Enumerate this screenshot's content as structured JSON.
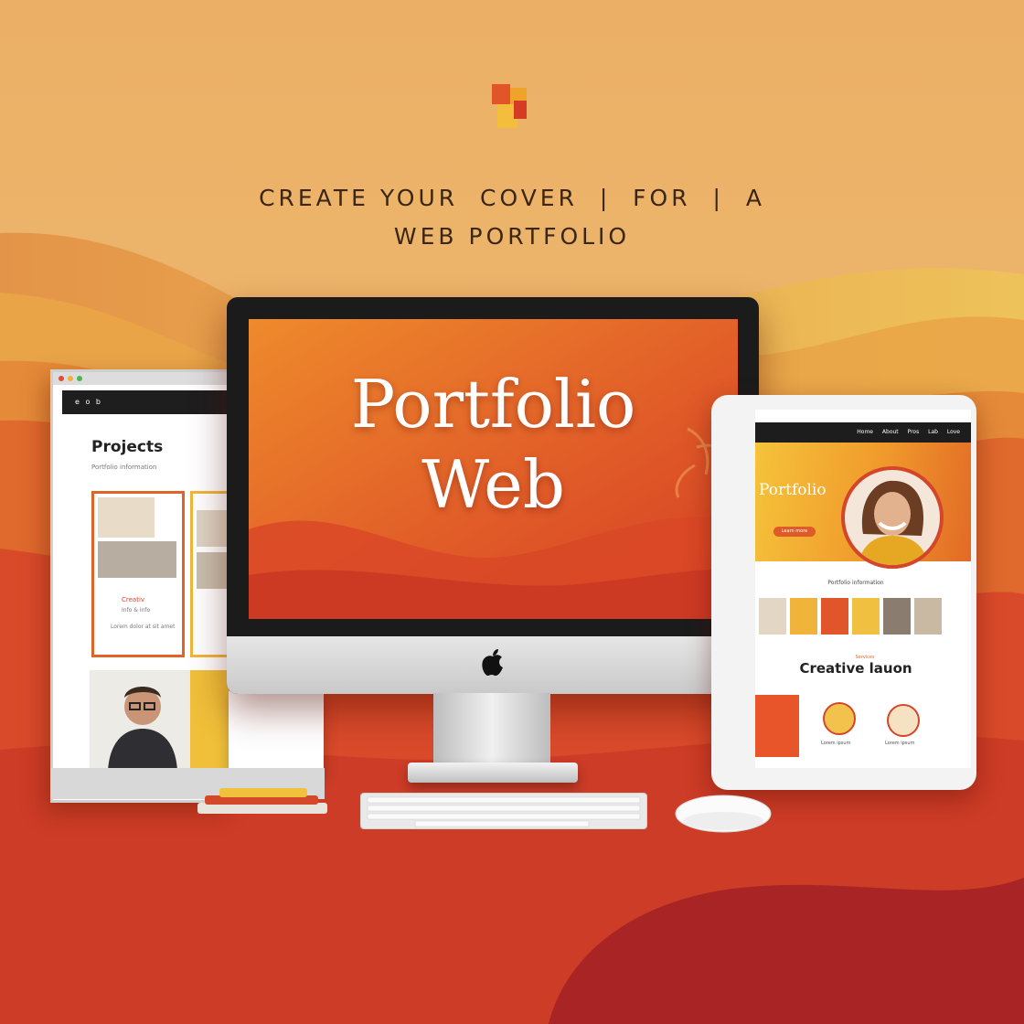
{
  "headline": {
    "line1": "CREATE YOUR  COVER  |  FOR  |  A",
    "line2": "WEB PORTFOLIO"
  },
  "main_screen": {
    "title_line1": "Portfolio",
    "title_line2": "Web"
  },
  "left_monitor": {
    "nav": "e o b",
    "title": "Projects",
    "subtitle": "Portfolio information",
    "card_label": "Creativ",
    "card_sub": "Info & Info",
    "card_line": "Lorem dolor at sit amet"
  },
  "tablet": {
    "nav": "Home About Pros Lab Love",
    "hero_title": "Portfolio",
    "hero_button": "Learn more",
    "caption": "Portfolio information",
    "section_sub": "Services",
    "section_title": "Creative lauon",
    "card_text": "Lorem ipsum"
  },
  "colors": {
    "background_top": "#eab06a",
    "orange": "#e2632a",
    "red": "#c93a25",
    "deep_red": "#9e2222",
    "yellow": "#f2c43a"
  },
  "icons": [
    "logo-icon",
    "apple-logo-icon"
  ]
}
